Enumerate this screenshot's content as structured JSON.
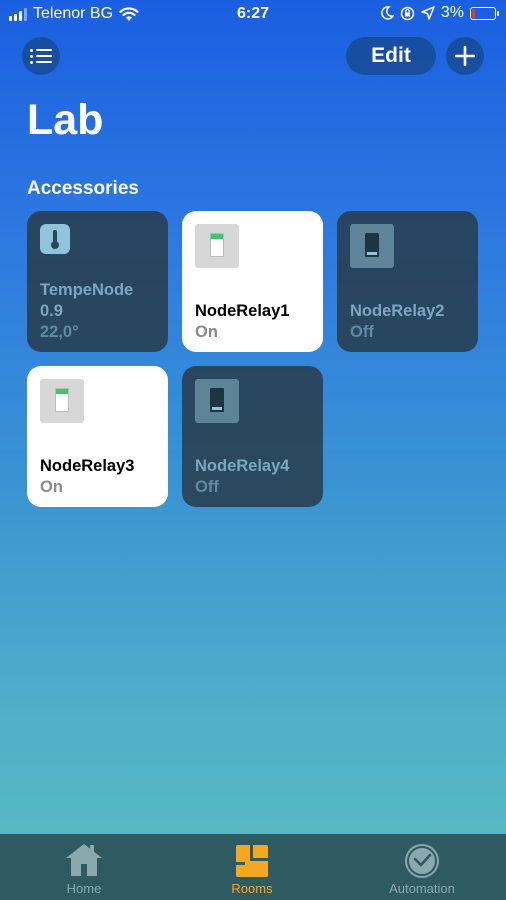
{
  "status_bar": {
    "carrier": "Telenor BG",
    "time": "6:27",
    "battery_percent": "3%"
  },
  "nav": {
    "edit_label": "Edit"
  },
  "page_title": "Lab",
  "section_title": "Accessories",
  "accessories": [
    {
      "name": "TempeNode",
      "name2": "0.9",
      "status": "22,0°",
      "state": "off",
      "icon": "thermometer-icon"
    },
    {
      "name": "NodeRelay1",
      "status": "On",
      "state": "on",
      "icon": "switch-icon"
    },
    {
      "name": "NodeRelay2",
      "status": "Off",
      "state": "off",
      "icon": "switch-icon"
    },
    {
      "name": "NodeRelay3",
      "status": "On",
      "state": "on",
      "icon": "switch-icon"
    },
    {
      "name": "NodeRelay4",
      "status": "Off",
      "state": "off",
      "icon": "switch-icon"
    }
  ],
  "tab_bar": {
    "tabs": [
      {
        "label": "Home",
        "icon": "home-icon"
      },
      {
        "label": "Rooms",
        "icon": "rooms-icon",
        "active": true
      },
      {
        "label": "Automation",
        "icon": "clock-icon"
      }
    ]
  },
  "colors": {
    "accent": "#f5a623",
    "relay_on_indicator": "#39c86a",
    "battery_low": "#ee3333"
  }
}
